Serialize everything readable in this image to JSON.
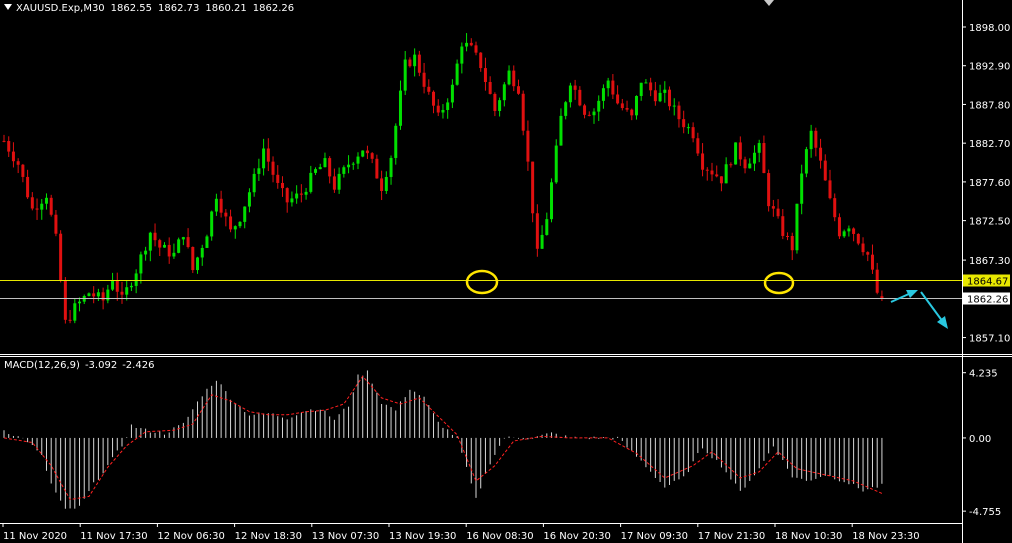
{
  "header": {
    "symbol": "XAUUSD.Exp,M30",
    "open": "1862.55",
    "high": "1862.73",
    "low": "1860.21",
    "close": "1862.26"
  },
  "macd_header": {
    "label": "MACD(12,26,9)",
    "main": "-3.092",
    "signal": "-2.426"
  },
  "colors": {
    "background": "#000000",
    "bull_candle": "#00e000",
    "bear_candle": "#e01010",
    "hline_yellow": "#e8e800",
    "hline_grey": "#c0c0c0",
    "annotation_circle": "#ffe600",
    "arrow": "#29c8e0",
    "macd_hist": "#d8d8d8",
    "macd_signal": "#ff2020"
  },
  "chart_data": [
    {
      "type": "candlestick",
      "title": "XAUUSD.Exp,M30",
      "y_ticks": [
        "1898.00",
        "1892.90",
        "1887.80",
        "1882.70",
        "1877.60",
        "1872.50",
        "1867.30",
        "1857.10"
      ],
      "ylim": [
        1855.2,
        1900.5
      ],
      "horizontal_lines": [
        {
          "value": 1864.67,
          "label": "1864.67",
          "color": "yellow"
        },
        {
          "value": 1862.26,
          "label": "1862.26",
          "color": "grey"
        }
      ],
      "x_ticks": [
        "11 Nov 2020",
        "11 Nov 17:30",
        "12 Nov 06:30",
        "12 Nov 18:30",
        "13 Nov 07:30",
        "13 Nov 19:30",
        "16 Nov 08:30",
        "16 Nov 20:30",
        "17 Nov 09:30",
        "17 Nov 21:30",
        "18 Nov 10:30",
        "18 Nov 23:30"
      ],
      "path_close": [
        [
          0,
          1883
        ],
        [
          3,
          1880
        ],
        [
          6,
          1874
        ],
        [
          9,
          1876
        ],
        [
          11,
          1870
        ],
        [
          13,
          1859
        ],
        [
          15,
          1861
        ],
        [
          18,
          1863
        ],
        [
          21,
          1862
        ],
        [
          23,
          1865
        ],
        [
          25,
          1862
        ],
        [
          28,
          1866
        ],
        [
          31,
          1871
        ],
        [
          33,
          1869
        ],
        [
          36,
          1868
        ],
        [
          38,
          1871
        ],
        [
          40,
          1866
        ],
        [
          43,
          1871
        ],
        [
          45,
          1876
        ],
        [
          48,
          1871
        ],
        [
          50,
          1873
        ],
        [
          53,
          1878
        ],
        [
          55,
          1882
        ],
        [
          58,
          1877
        ],
        [
          60,
          1875
        ],
        [
          63,
          1876
        ],
        [
          66,
          1879
        ],
        [
          68,
          1880
        ],
        [
          70,
          1877
        ],
        [
          73,
          1880
        ],
        [
          76,
          1882
        ],
        [
          78,
          1880
        ],
        [
          80,
          1877
        ],
        [
          82,
          1881
        ],
        [
          85,
          1893
        ],
        [
          87,
          1894
        ],
        [
          90,
          1889
        ],
        [
          92,
          1886
        ],
        [
          95,
          1890
        ],
        [
          97,
          1896
        ],
        [
          99,
          1895
        ],
        [
          101,
          1893
        ],
        [
          104,
          1887
        ],
        [
          107,
          1892
        ],
        [
          109,
          1890
        ],
        [
          111,
          1880
        ],
        [
          113,
          1868
        ],
        [
          115,
          1873
        ],
        [
          118,
          1886
        ],
        [
          120,
          1891
        ],
        [
          123,
          1887
        ],
        [
          125,
          1887
        ],
        [
          128,
          1891
        ],
        [
          130,
          1888
        ],
        [
          133,
          1886
        ],
        [
          135,
          1891
        ],
        [
          138,
          1889
        ],
        [
          140,
          1889
        ],
        [
          143,
          1886
        ],
        [
          146,
          1884
        ],
        [
          148,
          1880
        ],
        [
          150,
          1879
        ],
        [
          152,
          1878
        ],
        [
          155,
          1882
        ],
        [
          157,
          1880
        ],
        [
          160,
          1882
        ],
        [
          162,
          1875
        ],
        [
          165,
          1871
        ],
        [
          167,
          1869
        ],
        [
          169,
          1879
        ],
        [
          171,
          1884
        ],
        [
          173,
          1880
        ],
        [
          175,
          1875
        ],
        [
          177,
          1871
        ],
        [
          179,
          1872
        ],
        [
          181,
          1870
        ],
        [
          183,
          1868
        ],
        [
          185,
          1863
        ],
        [
          186,
          1862
        ]
      ],
      "ohlc": [
        {
          "o": 1862.55,
          "h": 1862.73,
          "l": 1860.21,
          "c": 1862.26
        }
      ]
    },
    {
      "type": "histogram+line",
      "title": "MACD(12,26,9)",
      "y_ticks": [
        "4.235",
        "0.00",
        "-4.755"
      ],
      "ylim": [
        -5.2,
        4.8
      ],
      "hist_path": [
        [
          0,
          0.5
        ],
        [
          5,
          -0.2
        ],
        [
          8,
          -1.2
        ],
        [
          10,
          -3
        ],
        [
          13,
          -4.7
        ],
        [
          16,
          -4.5
        ],
        [
          19,
          -3
        ],
        [
          22,
          -1.8
        ],
        [
          25,
          -0.5
        ],
        [
          27,
          0.8
        ],
        [
          30,
          0.5
        ],
        [
          34,
          0.3
        ],
        [
          38,
          0.9
        ],
        [
          42,
          2.8
        ],
        [
          45,
          3.8
        ],
        [
          48,
          2.6
        ],
        [
          52,
          1.5
        ],
        [
          56,
          1.6
        ],
        [
          60,
          1.3
        ],
        [
          64,
          1.8
        ],
        [
          67,
          1.9
        ],
        [
          70,
          1.2
        ],
        [
          73,
          2.1
        ],
        [
          75,
          4.0
        ],
        [
          77,
          4.3
        ],
        [
          80,
          2.3
        ],
        [
          83,
          1.8
        ],
        [
          86,
          3.2
        ],
        [
          89,
          2.6
        ],
        [
          92,
          1.0
        ],
        [
          96,
          0.0
        ],
        [
          100,
          -4.0
        ],
        [
          103,
          -1.6
        ],
        [
          106,
          0.0
        ],
        [
          112,
          0.0
        ],
        [
          116,
          0.3
        ],
        [
          120,
          0.0
        ],
        [
          125,
          0.0
        ],
        [
          130,
          0.0
        ],
        [
          135,
          -1.5
        ],
        [
          140,
          -3.2
        ],
        [
          144,
          -2.6
        ],
        [
          148,
          -0.6
        ],
        [
          152,
          -1.8
        ],
        [
          156,
          -3.5
        ],
        [
          160,
          -2.0
        ],
        [
          163,
          -0.5
        ],
        [
          167,
          -2.5
        ],
        [
          170,
          -2.8
        ],
        [
          174,
          -2.4
        ],
        [
          178,
          -2.8
        ],
        [
          182,
          -3.4
        ],
        [
          186,
          -3.1
        ]
      ],
      "signal_path": [
        [
          0,
          0.0
        ],
        [
          6,
          -0.3
        ],
        [
          10,
          -1.8
        ],
        [
          14,
          -4.0
        ],
        [
          18,
          -3.8
        ],
        [
          22,
          -1.9
        ],
        [
          26,
          -0.5
        ],
        [
          30,
          0.4
        ],
        [
          36,
          0.5
        ],
        [
          40,
          0.9
        ],
        [
          44,
          2.8
        ],
        [
          48,
          2.4
        ],
        [
          52,
          1.7
        ],
        [
          56,
          1.5
        ],
        [
          60,
          1.5
        ],
        [
          64,
          1.7
        ],
        [
          68,
          1.8
        ],
        [
          72,
          2.2
        ],
        [
          76,
          4.0
        ],
        [
          80,
          2.6
        ],
        [
          84,
          2.2
        ],
        [
          88,
          2.6
        ],
        [
          92,
          1.4
        ],
        [
          96,
          0.2
        ],
        [
          100,
          -2.8
        ],
        [
          104,
          -1.8
        ],
        [
          108,
          -0.2
        ],
        [
          114,
          0.1
        ],
        [
          120,
          0.0
        ],
        [
          128,
          0.0
        ],
        [
          134,
          -1.0
        ],
        [
          140,
          -2.6
        ],
        [
          146,
          -1.8
        ],
        [
          150,
          -0.9
        ],
        [
          156,
          -2.6
        ],
        [
          160,
          -2.2
        ],
        [
          164,
          -0.9
        ],
        [
          168,
          -2.0
        ],
        [
          174,
          -2.4
        ],
        [
          180,
          -2.8
        ],
        [
          186,
          -3.6
        ]
      ]
    }
  ]
}
